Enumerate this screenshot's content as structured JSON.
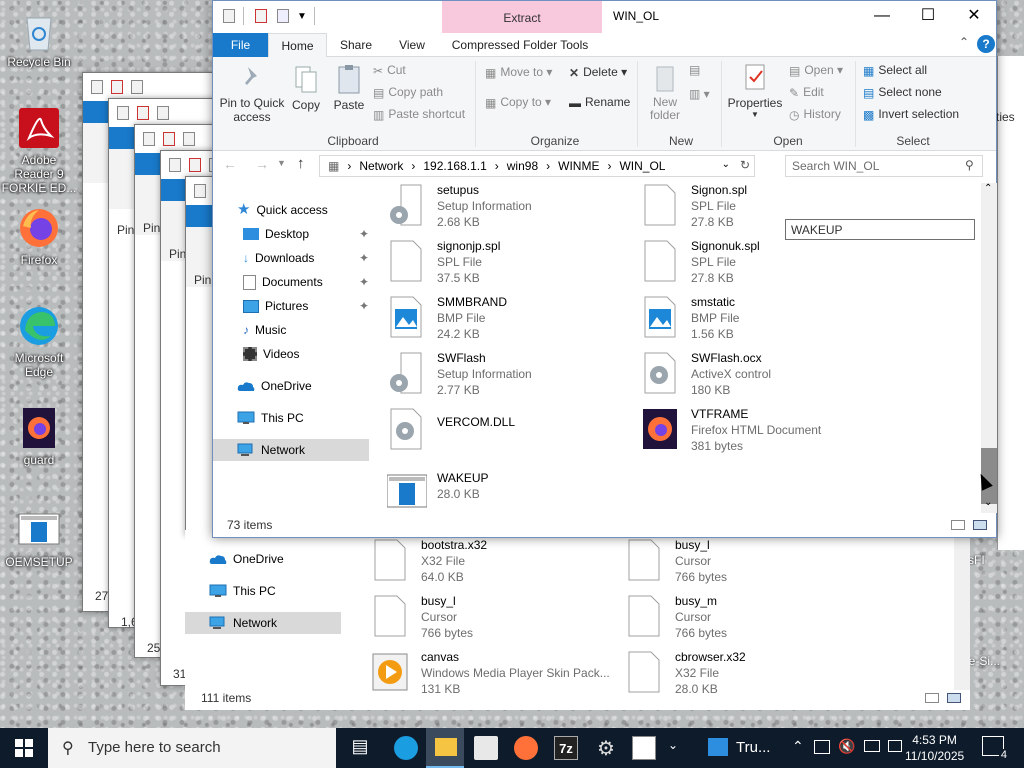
{
  "desktop": {
    "icons": [
      {
        "label": "Recycle Bin"
      },
      {
        "label": "Adobe Reader 9 FORKIE ED..."
      },
      {
        "label": "Firefox"
      },
      {
        "label": "Microsoft Edge"
      },
      {
        "label": "guard"
      },
      {
        "label": "OEMSETUP"
      }
    ],
    "right_partial_labels": [
      "rties",
      "sFI",
      "ore-Si..."
    ]
  },
  "stacked_windows": {
    "pin_labels": [
      "Pin",
      "Pin",
      "Pin",
      "Pin"
    ],
    "numbers": [
      "27",
      "1,6",
      "25",
      "31"
    ]
  },
  "window": {
    "title": "WIN_OL",
    "context_tab": "Extract",
    "controls": {
      "minimize": "—",
      "maximize": "☐",
      "close": "✕"
    },
    "tabs": {
      "file": "File",
      "home": "Home",
      "share": "Share",
      "view": "View",
      "compressed": "Compressed Folder Tools"
    },
    "ribbon": {
      "clipboard": {
        "pin": "Pin to Quick access",
        "copy": "Copy",
        "paste": "Paste",
        "cut": "Cut",
        "copy_path": "Copy path",
        "paste_shortcut": "Paste shortcut",
        "group": "Clipboard"
      },
      "organize": {
        "move_to": "Move to",
        "copy_to": "Copy to",
        "delete": "Delete",
        "rename": "Rename",
        "group": "Organize"
      },
      "new": {
        "new_folder": "New folder",
        "group": "New"
      },
      "open": {
        "properties": "Properties",
        "open": "Open",
        "edit": "Edit",
        "history": "History",
        "group": "Open"
      },
      "select": {
        "select_all": "Select all",
        "select_none": "Select none",
        "invert": "Invert selection",
        "group": "Select"
      }
    },
    "address": {
      "crumbs": [
        "Network",
        "192.168.1.1",
        "win98",
        "WINME",
        "WIN_OL"
      ],
      "search_placeholder": "Search WIN_OL"
    },
    "nav": {
      "quick_access": "Quick access",
      "desktop": "Desktop",
      "downloads": "Downloads",
      "documents": "Documents",
      "pictures": "Pictures",
      "music": "Music",
      "videos": "Videos",
      "onedrive": "OneDrive",
      "thispc": "This PC",
      "network": "Network"
    },
    "files": [
      {
        "name": "setupus",
        "type": "Setup Information",
        "size": "2.68 KB",
        "icon": "gear-file-icon"
      },
      {
        "name": "Signon.spl",
        "type": "SPL File",
        "size": "27.8 KB",
        "icon": "blank-file-icon"
      },
      {
        "name": "signonjp.spl",
        "type": "SPL File",
        "size": "37.5 KB",
        "icon": "blank-file-icon"
      },
      {
        "name": "Signonuk.spl",
        "type": "SPL File",
        "size": "27.8 KB",
        "icon": "blank-file-icon"
      },
      {
        "name": "SMMBRAND",
        "type": "BMP File",
        "size": "24.2 KB",
        "icon": "image-file-icon"
      },
      {
        "name": "smstatic",
        "type": "BMP File",
        "size": "1.56 KB",
        "icon": "image-file-icon"
      },
      {
        "name": "SWFlash",
        "type": "Setup Information",
        "size": "2.77 KB",
        "icon": "gear-file-icon"
      },
      {
        "name": "SWFlash.ocx",
        "type": "ActiveX control",
        "size": "180 KB",
        "icon": "gear-file-icon"
      },
      {
        "name": "VERCOM.DLL",
        "type": "",
        "size": "",
        "icon": "gear-file-icon"
      },
      {
        "name": "VTFRAME",
        "type": "Firefox HTML Document",
        "size": "381 bytes",
        "icon": "firefox-file-icon"
      },
      {
        "name": "WAKEUP",
        "type": "",
        "size": "28.0 KB",
        "icon": "app-window-icon"
      }
    ],
    "rename_value": "WAKEUP",
    "status": "73 items"
  },
  "back_window": {
    "nav": {
      "onedrive": "OneDrive",
      "thispc": "This PC",
      "network": "Network"
    },
    "files": [
      {
        "name": "bootstra.x32",
        "type": "X32 File",
        "size": "64.0 KB"
      },
      {
        "name": "busy_l",
        "type": "Cursor",
        "size": "766 bytes"
      },
      {
        "name": "busy_l",
        "type": "Cursor",
        "size": "766 bytes"
      },
      {
        "name": "busy_m",
        "type": "Cursor",
        "size": "766 bytes"
      },
      {
        "name": "canvas",
        "type": "Windows Media Player Skin Pack...",
        "size": "131 KB"
      },
      {
        "name": "cbrowser.x32",
        "type": "X32 File",
        "size": "28.0 KB"
      }
    ],
    "status": "111 items"
  },
  "taskbar": {
    "search_placeholder": "Type here to search",
    "app_label": "Tru...",
    "time": "4:53 PM",
    "date": "11/10/2025",
    "notification_count": "4"
  },
  "colors": {
    "accent": "#1979ca",
    "extract_tab": "#f8c8dc",
    "taskbar": "#0e1b2a",
    "nav_selected": "#cce8ff"
  }
}
